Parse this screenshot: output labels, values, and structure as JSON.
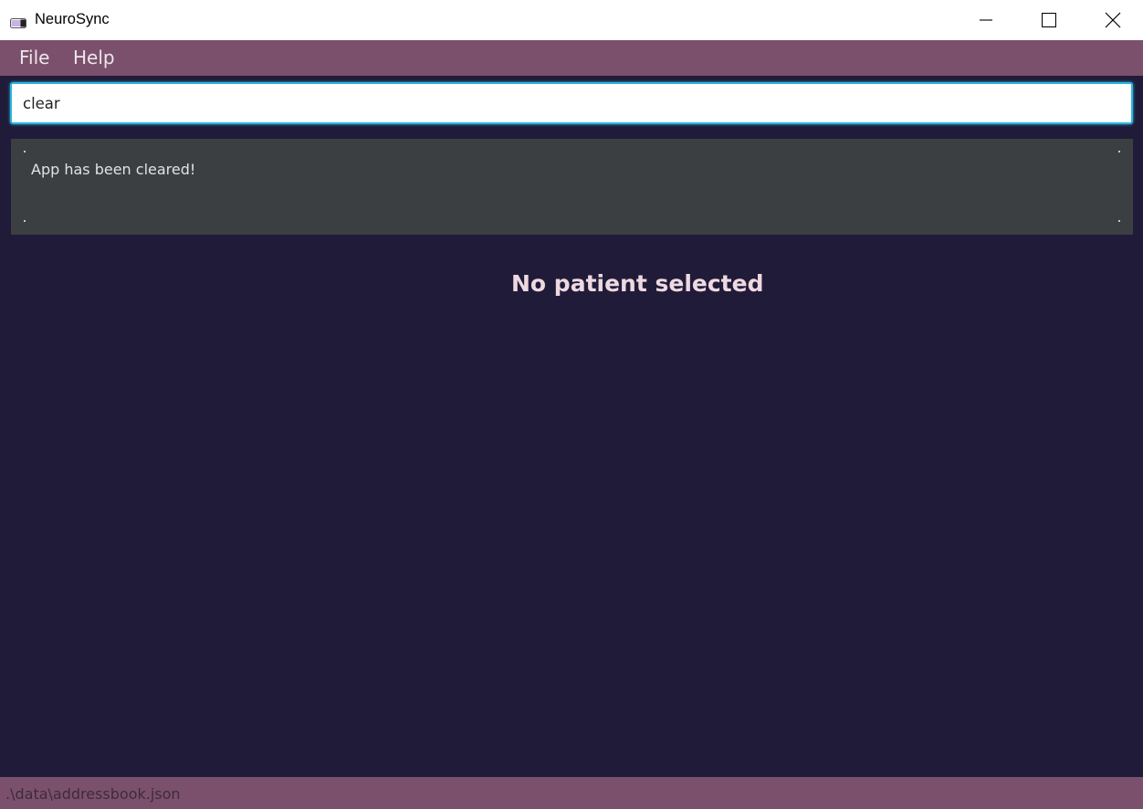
{
  "window": {
    "title": "NeuroSync",
    "icon": "pill-icon",
    "controls": [
      "minimize-icon",
      "maximize-icon",
      "close-icon"
    ]
  },
  "menu": {
    "file_label": "File",
    "help_label": "Help"
  },
  "command": {
    "value": "clear"
  },
  "result": {
    "message": "App has been cleared!"
  },
  "detail": {
    "placeholder": "No patient selected"
  },
  "status": {
    "file_path": ".\\data\\addressbook.json"
  },
  "colors": {
    "background": "#201b39",
    "accent_bar": "#7b506d",
    "result_panel": "#3b3f41",
    "input_focus": "#2ab4dc"
  }
}
